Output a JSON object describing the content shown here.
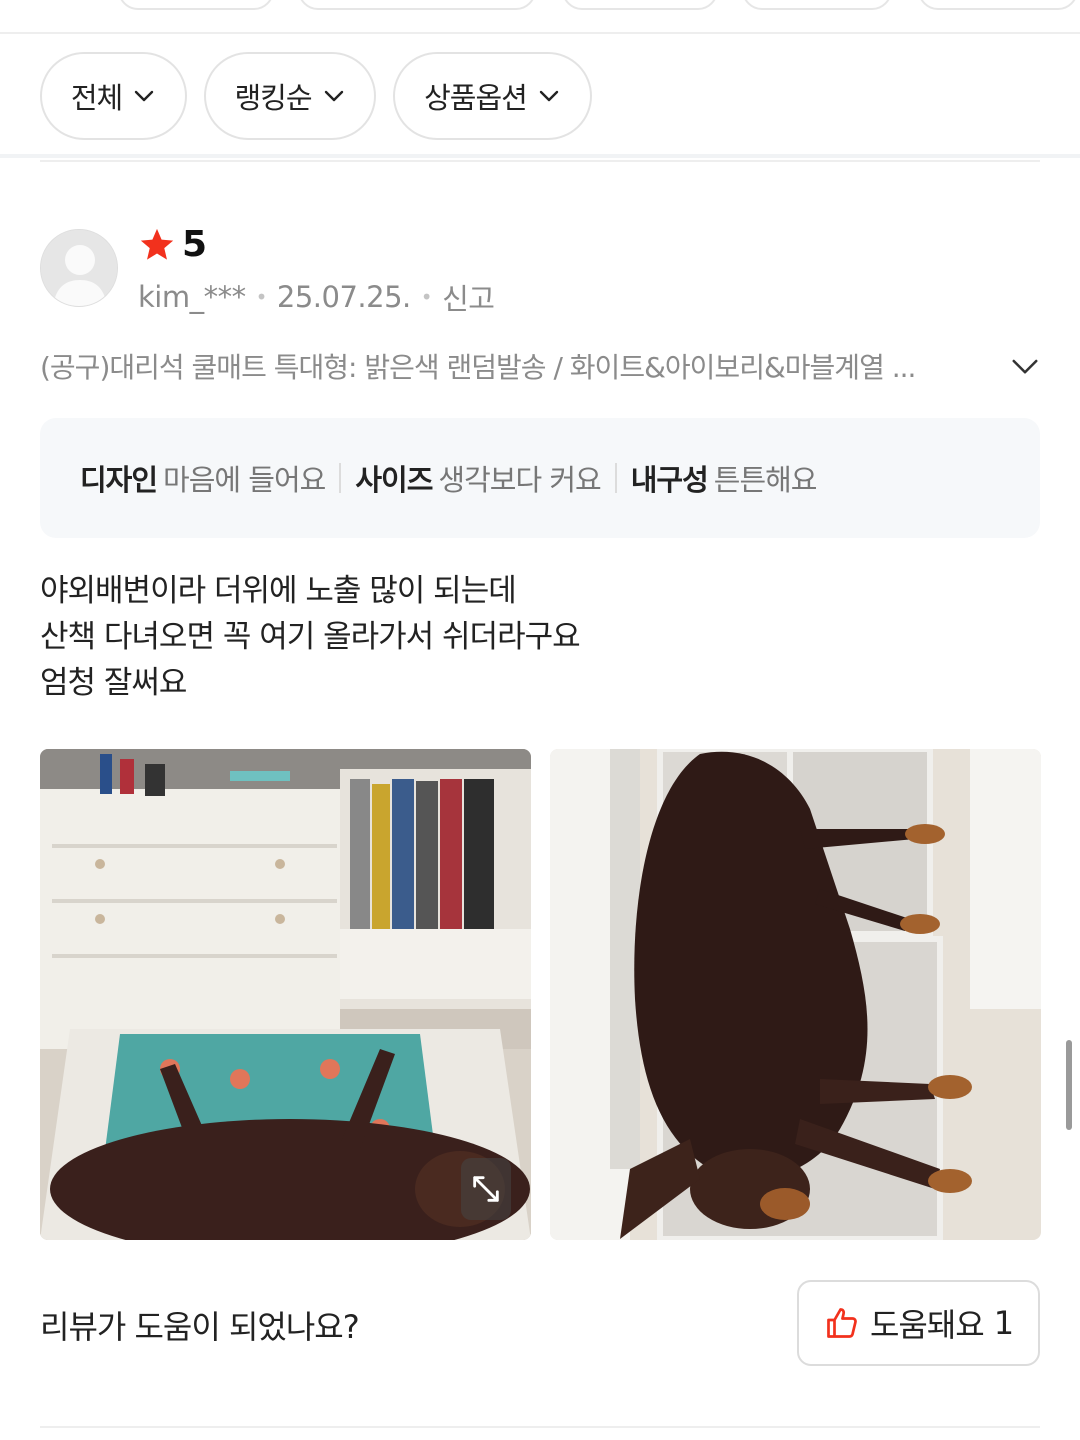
{
  "filters": [
    {
      "label": "전체"
    },
    {
      "label": "랭킹순"
    },
    {
      "label": "상품옵션"
    }
  ],
  "review": {
    "rating": "5",
    "author": "kim_***",
    "date": "25.07.25.",
    "report_label": "신고",
    "option_text": "(공구)대리석 쿨매트 특대형: 밝은색 랜덤발송 / 화이트&아이보리&마블계열 ...",
    "survey": [
      {
        "key": "디자인",
        "value": "마음에 들어요"
      },
      {
        "key": "사이즈",
        "value": "생각보다 커요"
      },
      {
        "key": "내구성",
        "value": "튼튼해요"
      }
    ],
    "body_lines": [
      "야외배변이라 더위에 노출 많이 되는데",
      "산책 다녀오면 꼭 여기 올라가서 쉬더라구요",
      "엄청 잘써요"
    ]
  },
  "helpful": {
    "question": "리뷰가 도움이 되었나요?",
    "button_label": "도움돼요",
    "count": "1"
  },
  "colors": {
    "star": "#f2311d",
    "helpful_icon": "#f2311d",
    "meta_text": "#8b8b8b",
    "survey_bg": "#f6f8fa"
  },
  "icons": {
    "rating": "star-icon",
    "dropdown": "chevron-down-icon",
    "expand": "expand-icon",
    "helpful": "thumbs-up-icon",
    "avatar": "default-avatar-icon"
  }
}
